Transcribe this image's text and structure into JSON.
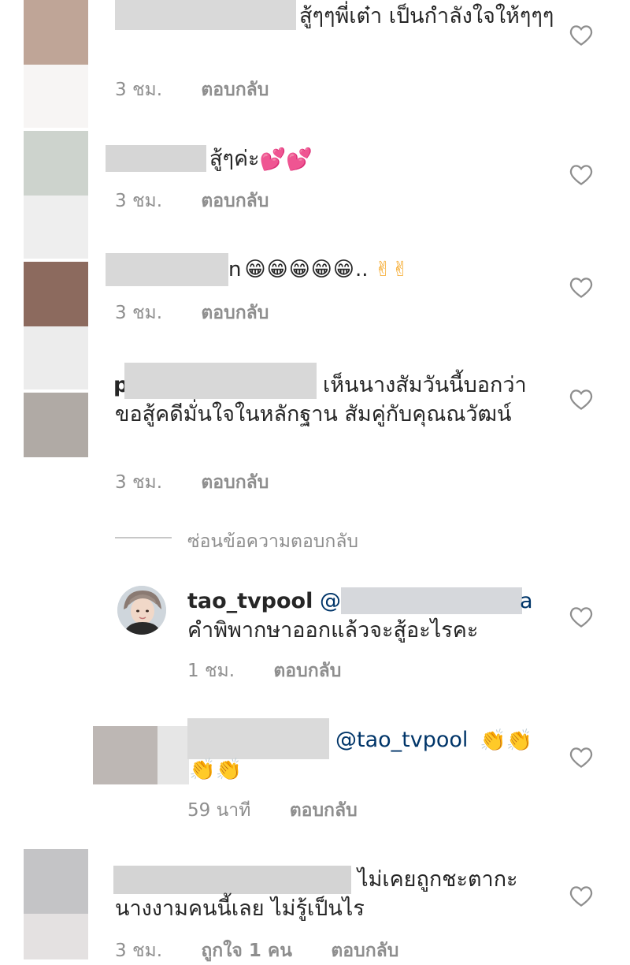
{
  "comments": [
    {
      "text": "สู้ๆๆพี่เต๋า เป็นกำลังใจให้ๆๆๆ",
      "time": "3 ชม.",
      "reply_label": "ตอบกลับ"
    },
    {
      "text": "สู้ๆค่ะ",
      "emoji": "💕💕",
      "time": "3 ชม.",
      "reply_label": "ตอบกลับ"
    },
    {
      "text_prefix": "n",
      "emoji": "😁😁😁😁😁",
      "dots": "..",
      "emoji2": "✌✌",
      "time": "3 ชม.",
      "reply_label": "ตอบกลับ"
    },
    {
      "username_initial": "p",
      "text": "เห็นนางสัมวันนี้บอกว่าขอสู้คดีมั่นใจในหลักฐาน สัมคู่กับคุณณวัฒน์",
      "time": "3 ชม.",
      "reply_label": "ตอบกลับ"
    }
  ],
  "hide_replies_label": "ซ่อนข้อความตอบกลับ",
  "replies": [
    {
      "username": "tao_tvpool",
      "mention_start": "@p",
      "mention_end": "a",
      "text": "คำพิพากษาออกแล้วจะสู้อะไรคะ",
      "time": "1 ชม.",
      "reply_label": "ตอบกลับ"
    },
    {
      "mention": "@tao_tvpool",
      "emoji": "👏👏",
      "emoji_line2": "👏👏",
      "time": "59 นาที",
      "reply_label": "ตอบกลับ"
    }
  ],
  "last_comment": {
    "text": "ไม่เคยถูกชะตากะนางงามคนนี้เลย ไม่รู้เป็นไร",
    "time": "3 ชม.",
    "likes": "ถูกใจ 1 คน",
    "reply_label": "ตอบกลับ"
  },
  "icons": {
    "like": "heart-outline-icon"
  },
  "colors": {
    "text": "#262626",
    "meta": "#8e8e8e",
    "mention": "#003569",
    "blur": "#d6d6d6"
  }
}
